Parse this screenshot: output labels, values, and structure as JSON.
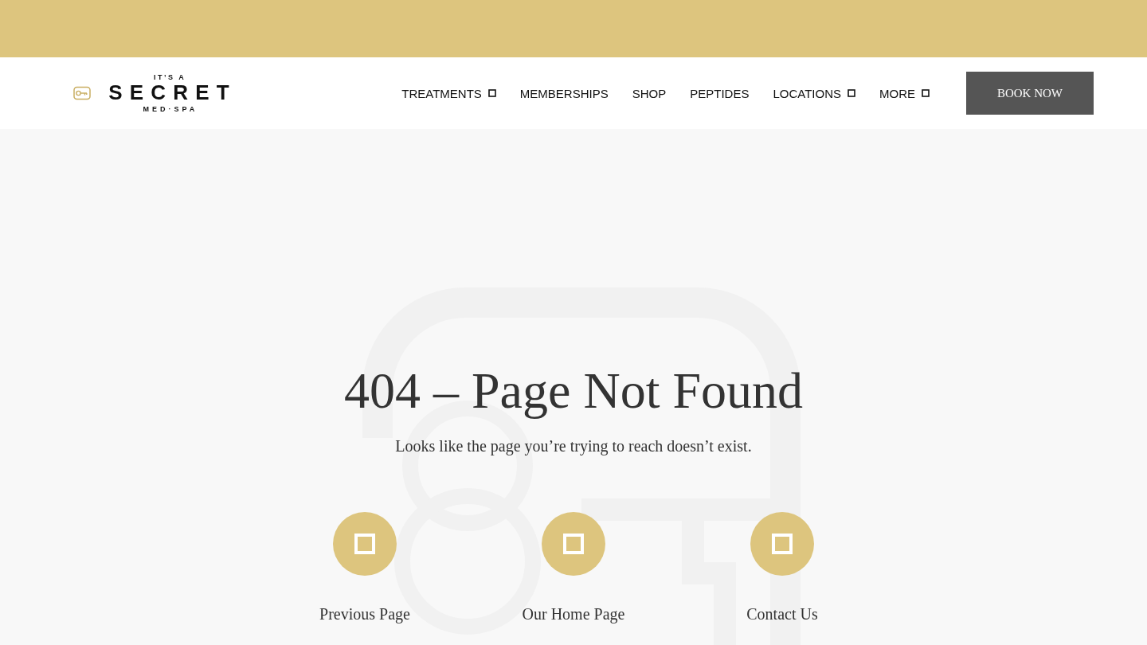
{
  "logo": {
    "tagline": "IT’S A",
    "wordmark": "SECRET",
    "subtitle": "MED·SPA"
  },
  "nav": [
    {
      "label": "TREATMENTS",
      "dropdown": true
    },
    {
      "label": "MEMBERSHIPS",
      "dropdown": false
    },
    {
      "label": "SHOP",
      "dropdown": false
    },
    {
      "label": "PEPTIDES",
      "dropdown": false
    },
    {
      "label": "LOCATIONS",
      "dropdown": true
    },
    {
      "label": "MORE",
      "dropdown": true
    }
  ],
  "book_button": {
    "label": "BOOK NOW"
  },
  "error": {
    "title": "404 – Page Not Found",
    "message": "Looks like the page you’re trying to reach doesn’t exist."
  },
  "links": [
    {
      "label": "Previous Page"
    },
    {
      "label": "Our Home Page"
    },
    {
      "label": "Contact Us"
    }
  ]
}
